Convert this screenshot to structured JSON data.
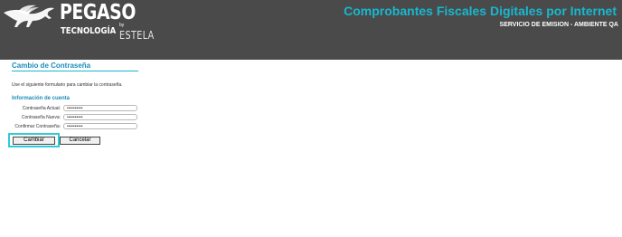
{
  "header": {
    "logo": {
      "name": "PEGASO",
      "sub": "TECNOLOGÍA",
      "by": "by",
      "partner": "ESTELA"
    },
    "title": "Comprobantes Fiscales Digitales por Internet",
    "subtitle": "SERVICIO DE EMISION - AMBIENTE QA"
  },
  "main": {
    "section_title": "Cambio de Contraseña",
    "instructions": "Use el siguiente formulario para cambiar la contraseña.",
    "subsection_title": "Información de cuenta",
    "fields": [
      {
        "label": "Contraseña Actual:",
        "value": "••••••••••"
      },
      {
        "label": "Contraseña Nueva:",
        "value": "••••••••••"
      },
      {
        "label": "Confirmar Contraseña:",
        "value": "••••••••••"
      }
    ],
    "buttons": {
      "submit_label": "Cambiar",
      "cancel_label": "Cancelar"
    }
  },
  "colors": {
    "header_bg": "#4a4a4a",
    "accent": "#17b8cf",
    "section_title": "#1b8db8",
    "focus_highlight": "#2ccbd8"
  }
}
